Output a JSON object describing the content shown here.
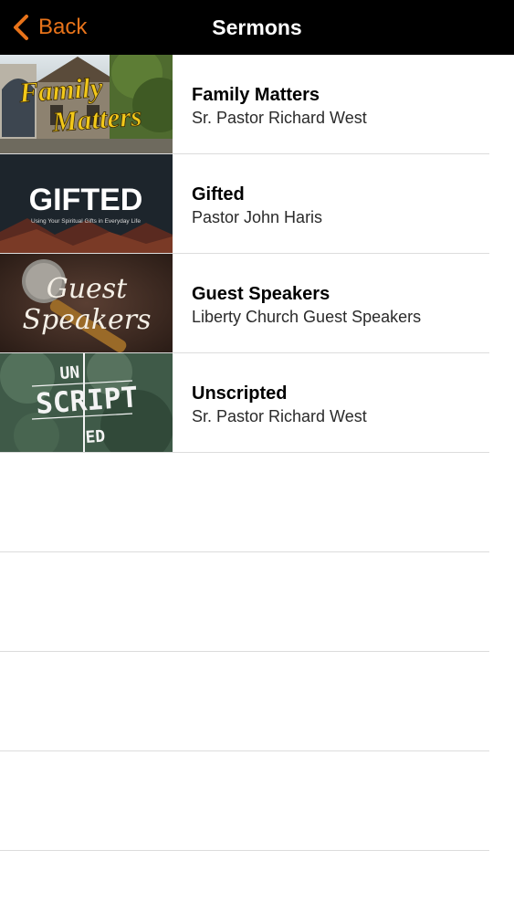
{
  "nav": {
    "back_label": "Back",
    "title": "Sermons",
    "accent_color": "#e8731a"
  },
  "sermons": [
    {
      "title": "Family Matters",
      "speaker": "Sr. Pastor Richard West",
      "artwork_text": [
        "Family",
        "Matters"
      ]
    },
    {
      "title": "Gifted",
      "speaker": "Pastor John Haris",
      "artwork_text": [
        "GIFTED",
        "Using Your Spiritual Gifts in Everyday Life"
      ]
    },
    {
      "title": "Guest Speakers",
      "speaker": "Liberty Church Guest Speakers",
      "artwork_text": [
        "Guest",
        "Speakers"
      ]
    },
    {
      "title": "Unscripted",
      "speaker": "Sr. Pastor Richard West",
      "artwork_text": [
        "UN",
        "SCRIPT",
        "ED"
      ]
    }
  ]
}
